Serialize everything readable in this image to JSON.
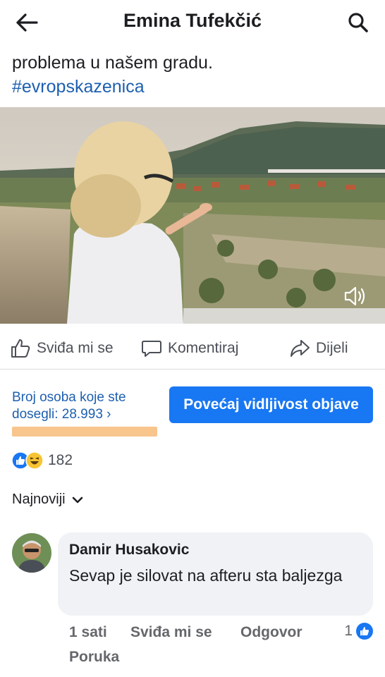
{
  "header": {
    "title": "Emina Tufekčić",
    "back_icon": "arrow-left-icon",
    "search_icon": "search-icon"
  },
  "post": {
    "text_line": "problema u našem gradu.",
    "hashtag": "#evropskazenica"
  },
  "actions": {
    "like_label": "Sviđa mi se",
    "comment_label": "Komentiraj",
    "share_label": "Dijeli"
  },
  "insights": {
    "reach_text": "Broj osoba koje ste dosegli: 28.993",
    "reach_chevron": "›",
    "boost_label": "Povećaj vidljivost objave"
  },
  "reactions": {
    "count": "182",
    "types": [
      "like",
      "haha"
    ]
  },
  "sort": {
    "label": "Najnoviji"
  },
  "comment": {
    "author": "Damir Husakovic",
    "text": "Sevap je silovat na afteru sta baljezga",
    "time": "1 sati",
    "like_label": "Sviđa mi se",
    "reply_label": "Odgovor",
    "message_label": "Poruka",
    "like_count": "1"
  },
  "colors": {
    "accent": "#1877f2",
    "link": "#1d5fb0",
    "reach_bar": "#f8c58d",
    "bubble": "#f0f2f5"
  }
}
